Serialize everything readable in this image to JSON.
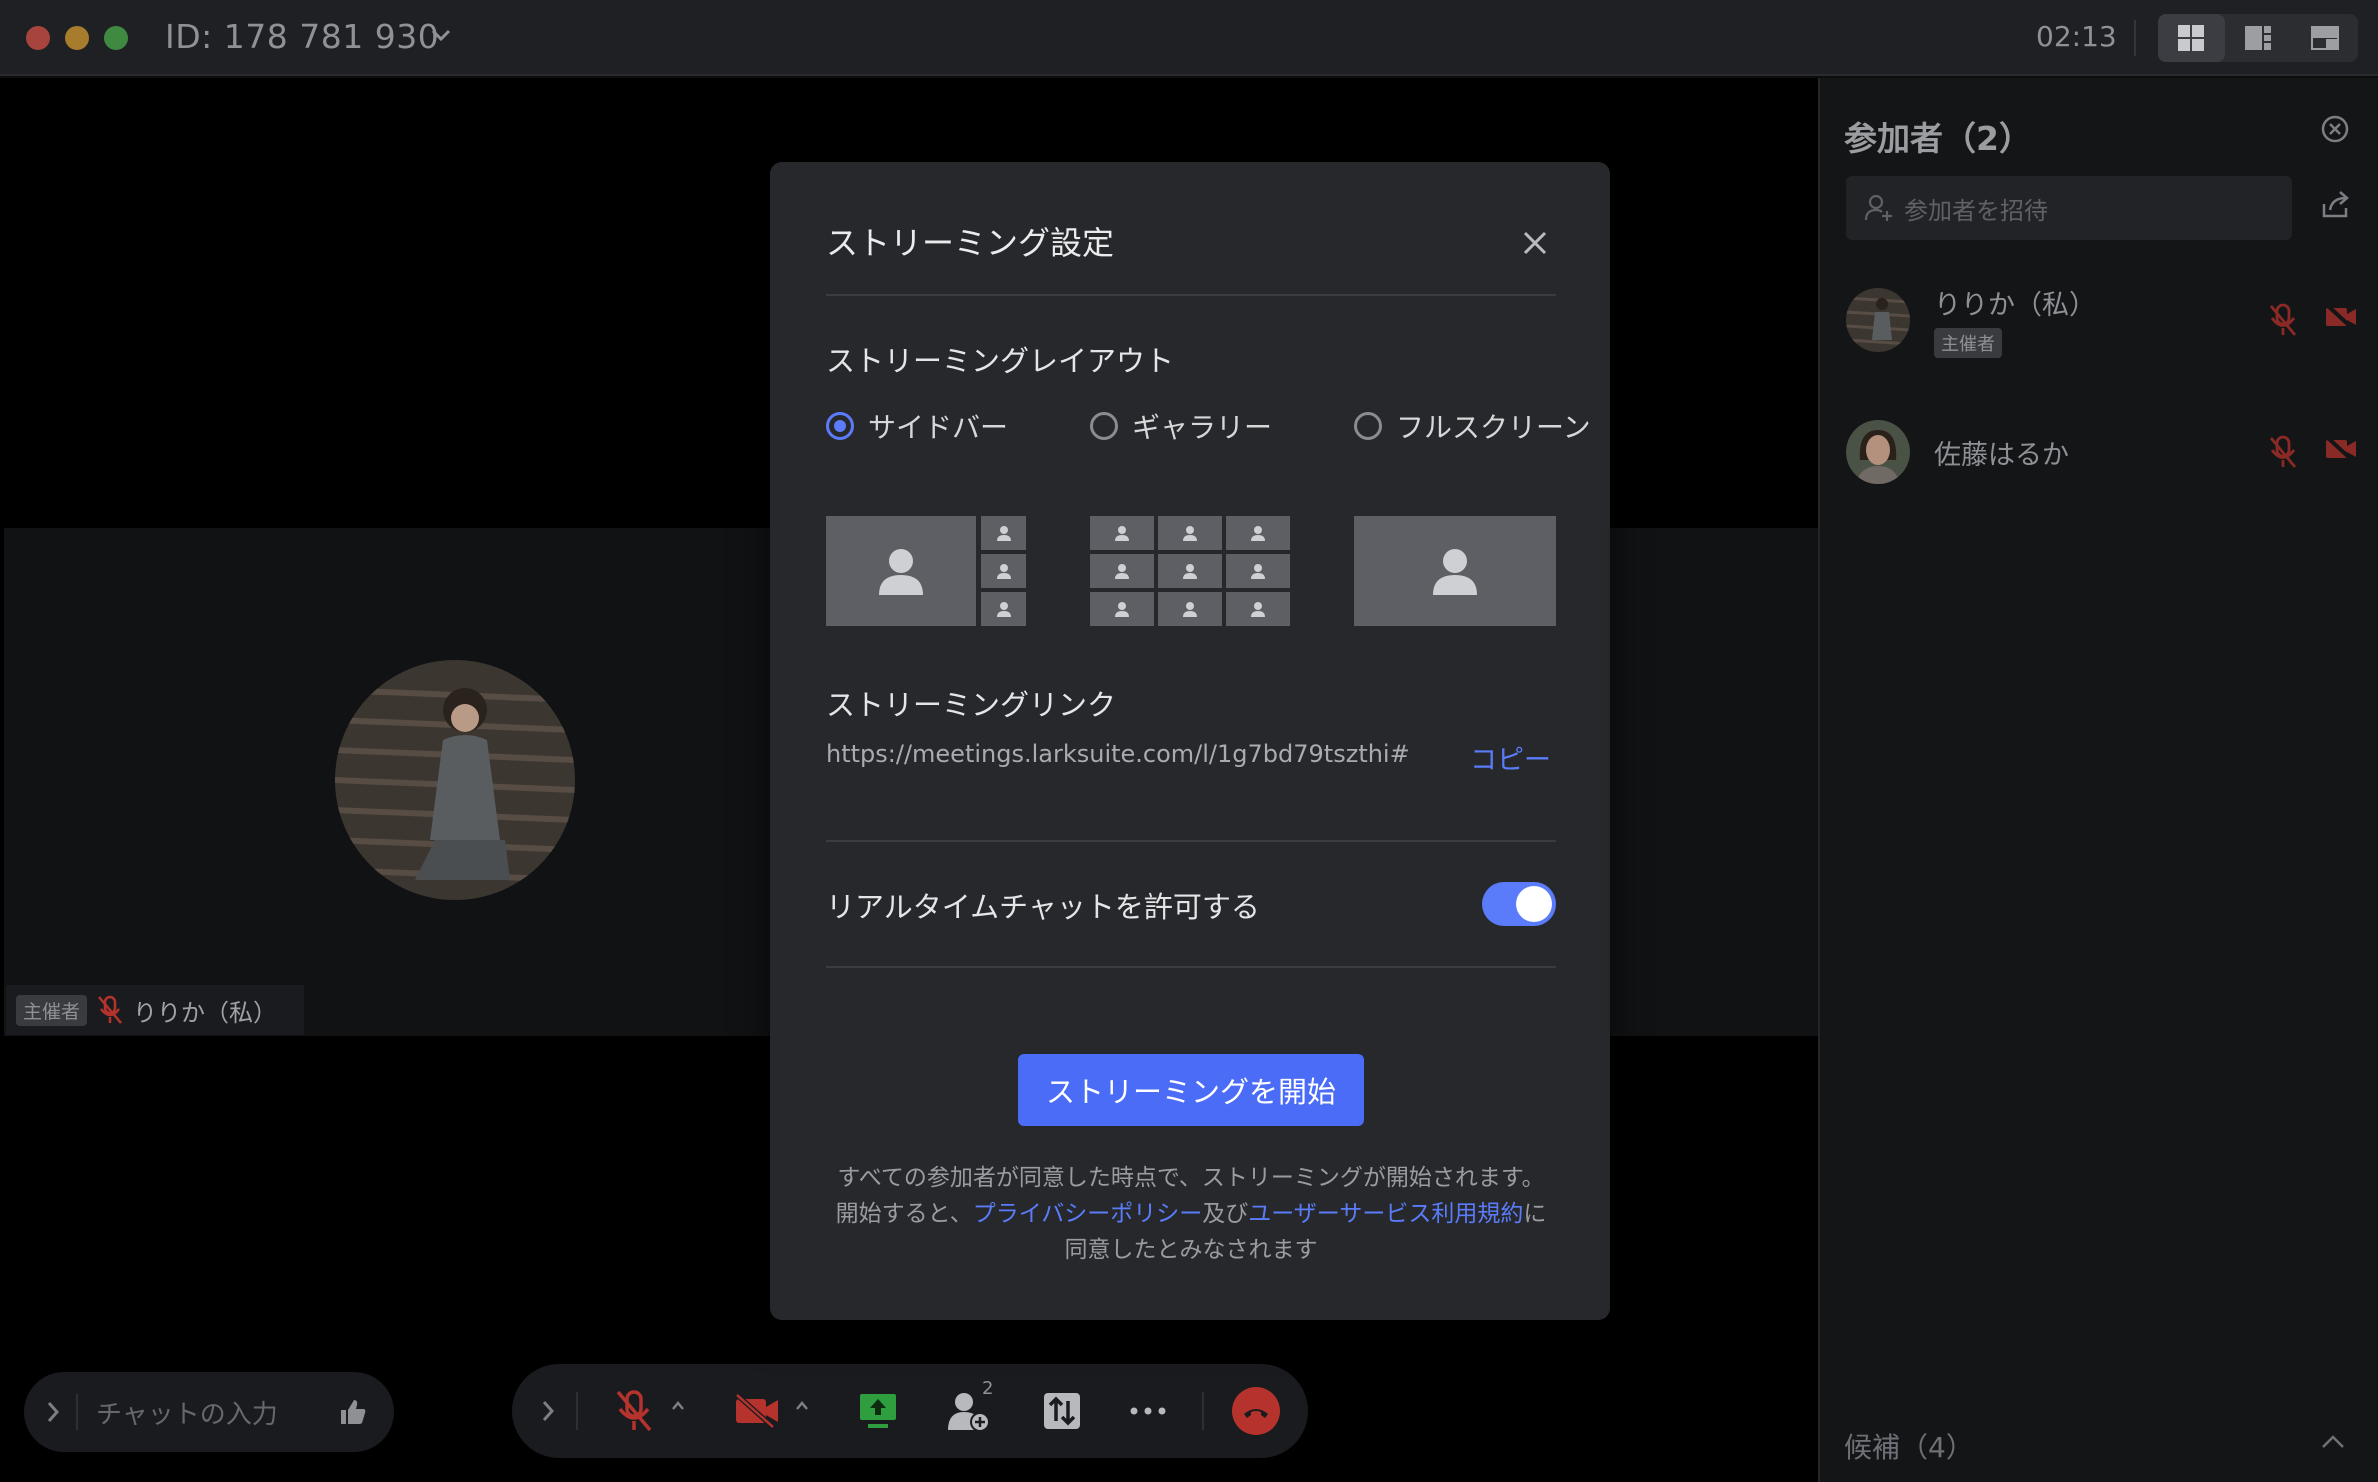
{
  "titlebar": {
    "meeting_id": "ID: 178 781 930",
    "timer": "02:13"
  },
  "stage": {
    "tile": {
      "host_tag": "主催者",
      "name": "りりか（私）"
    }
  },
  "chat": {
    "placeholder": "チャットの入力"
  },
  "controls": {
    "invite_count": "2"
  },
  "participants_panel": {
    "title": "参加者（2）",
    "invite_placeholder": "参加者を招待",
    "participants": [
      {
        "name": "りりか（私）",
        "badge": "主催者"
      },
      {
        "name": "佐藤はるか"
      }
    ],
    "candidates": "候補（4）"
  },
  "dialog": {
    "title": "ストリーミング設定",
    "layout_section": "ストリーミングレイアウト",
    "layout_options": [
      {
        "label": "サイドバー",
        "selected": true
      },
      {
        "label": "ギャラリー",
        "selected": false
      },
      {
        "label": "フルスクリーン",
        "selected": false
      }
    ],
    "link_section": "ストリーミングリンク",
    "link_url": "https://meetings.larksuite.com/l/1g7bd79tszthi#",
    "copy_label": "コピー",
    "chat_toggle_label": "リアルタイムチャットを許可する",
    "chat_toggle_on": true,
    "start_button": "ストリーミングを開始",
    "disclaimer": {
      "part1": "すべての参加者が同意した時点で、ストリーミングが開始されます。開始すると、",
      "privacy_link": "プライバシーポリシー",
      "part2": "及び",
      "terms_link": "ユーザーサービス利用規約",
      "part3": "に同意したとみなされます"
    }
  },
  "colors": {
    "accent": "#4a6cf7",
    "mute_red": "#b6332d",
    "share_green": "#2e9e3e"
  }
}
